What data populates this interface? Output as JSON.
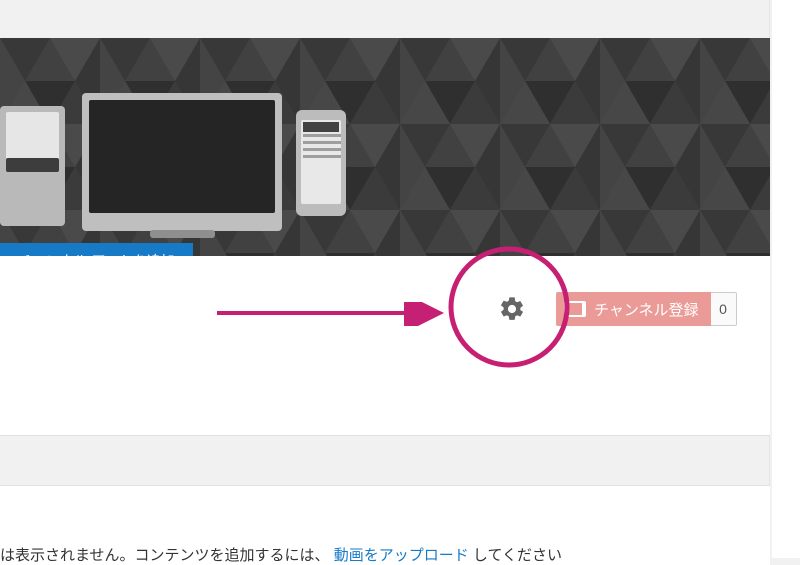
{
  "banner": {
    "add_art_label": "チャンネル アートを追加"
  },
  "actions": {
    "subscribe_label": "チャンネル登録",
    "subscribe_count": "0"
  },
  "lower": {
    "text_prefix": "は表示されません。コンテンツを追加するには、",
    "link_text": "動画をアップロード",
    "text_suffix": "してください"
  },
  "annotation": {
    "circle_color": "#c62074",
    "arrow_color": "#c62074"
  }
}
